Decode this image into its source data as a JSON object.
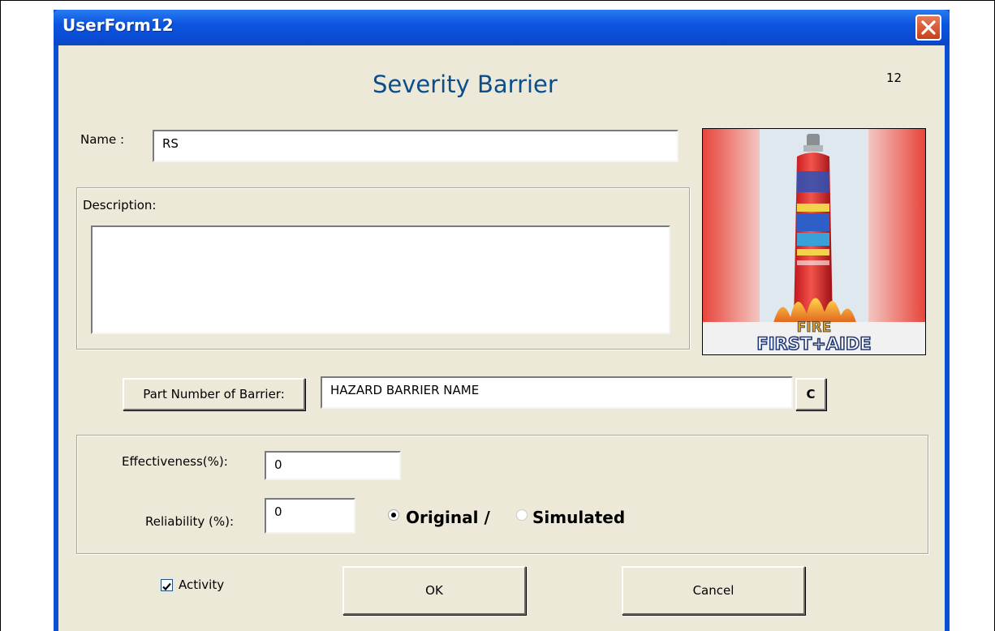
{
  "window": {
    "title": "UserForm12",
    "close_icon": "close-icon"
  },
  "form": {
    "number": "12",
    "heading": "Severity Barrier"
  },
  "name_field": {
    "label": "Name :",
    "value": "RS"
  },
  "description": {
    "label": "Description:",
    "value": ""
  },
  "product_image": {
    "brand_lines": [
      "FIRE",
      "FIRST+AIDE"
    ]
  },
  "part_number": {
    "button_label": "Part Number of Barrier:",
    "value": "HAZARD BARRIER NAME",
    "clear_button_label": "C"
  },
  "effectiveness": {
    "label": "Effectiveness(%):",
    "value": "0"
  },
  "reliability": {
    "label": "Reliability (%):",
    "value": "0"
  },
  "mode": {
    "original_label": "Original /",
    "simulated_label": "Simulated",
    "selected": "original"
  },
  "activity": {
    "label": "Activity",
    "checked": true
  },
  "buttons": {
    "ok_label": "OK",
    "cancel_label": "Cancel"
  },
  "colors": {
    "title_bar": "#0c55e0",
    "form_background": "#ece9d8",
    "heading_text": "#0b4e8e",
    "close_button": "#c8401a"
  }
}
